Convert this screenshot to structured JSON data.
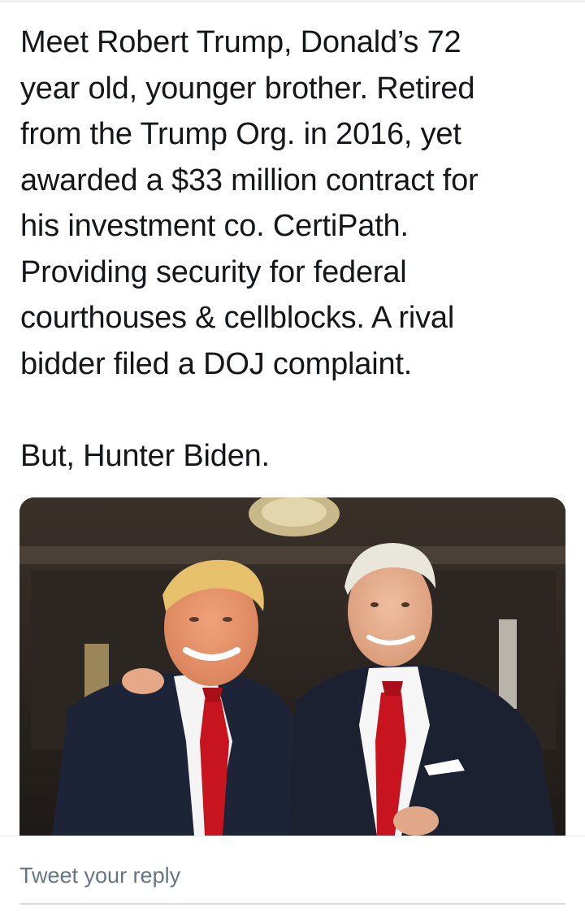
{
  "tweet": {
    "lines": [
      "Meet Robert Trump, Donald’s 72",
      "year old, younger brother. Retired",
      "from the Trump Org. in 2016, yet",
      "awarded a $33 million contract for",
      "his investment co. CertiPath.",
      "Providing security for federal",
      "courthouses & cellblocks. A rival",
      "bidder filed a DOJ complaint."
    ],
    "closing": "But, Hunter Biden."
  },
  "reply": {
    "placeholder": "Tweet your reply"
  },
  "colors": {
    "text": "#14171a",
    "placeholder": "#657786",
    "divider": "#e6ecf0",
    "tie_red": "#c8141e",
    "suit_navy": "#1d2438"
  }
}
